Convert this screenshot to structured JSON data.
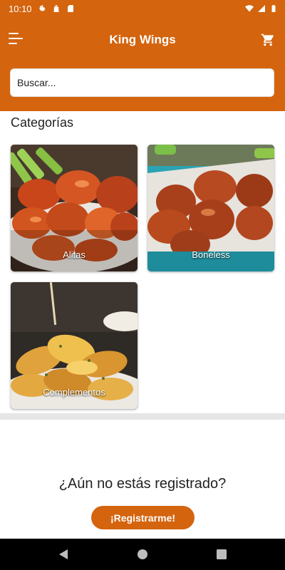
{
  "status_bar": {
    "time": "10:10",
    "icons": [
      "gear-icon",
      "bag-icon",
      "sd-card-icon",
      "wifi-icon",
      "signal-icon",
      "battery-icon"
    ]
  },
  "app_bar": {
    "title": "King Wings",
    "menu_icon": "menu-icon",
    "cart_icon": "cart-icon",
    "color": "#d4640e"
  },
  "search": {
    "placeholder": "Buscar..."
  },
  "categories": {
    "title": "Categorías",
    "items": [
      {
        "label": "Alitas"
      },
      {
        "label": "Boneless"
      },
      {
        "label": "Complementos"
      }
    ]
  },
  "register": {
    "question": "¿Aún no estás registrado?",
    "button_label": "¡Registrarme!"
  },
  "nav_bar": {
    "icons": [
      "back-icon",
      "home-icon",
      "recent-apps-icon"
    ]
  }
}
